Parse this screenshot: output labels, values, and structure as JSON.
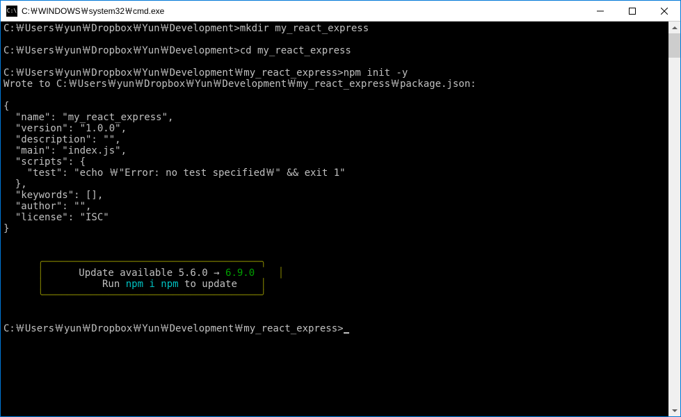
{
  "titlebar": {
    "icon_label": "C:\\",
    "title": "C:￦WINDOWS￦system32￦cmd.exe"
  },
  "terminal": {
    "prompt1": "C:￦Users￦yun￦Dropbox￦Yun￦Development>",
    "cmd1": "mkdir my_react_express",
    "prompt2": "C:￦Users￦yun￦Dropbox￦Yun￦Development>",
    "cmd2": "cd my_react_express",
    "prompt3": "C:￦Users￦yun￦Dropbox￦Yun￦Development￦my_react_express>",
    "cmd3": "npm init -y",
    "wrote_line": "Wrote to C:￦Users￦yun￦Dropbox￦Yun￦Development￦my_react_express￦package.json:",
    "json_open": "{",
    "json_name": "  \"name\": \"my_react_express\",",
    "json_version": "  \"version\": \"1.0.0\",",
    "json_description": "  \"description\": \"\",",
    "json_main": "  \"main\": \"index.js\",",
    "json_scripts_open": "  \"scripts\": {",
    "json_test": "    \"test\": \"echo ￦\"Error: no test specified￦\" && exit 1\"",
    "json_scripts_close": "  },",
    "json_keywords": "  \"keywords\": [],",
    "json_author": "  \"author\": \"\",",
    "json_license": "  \"license\": \"ISC\"",
    "json_close": "}",
    "update_text1_a": "      Update available 5.6.0 → ",
    "update_text1_b": "6.9.0",
    "update_text2_a": "          Run ",
    "update_text2_b": "npm i npm",
    "update_text2_c": " to update",
    "box_top": "   ╭─────────────────────────────────────╮",
    "box_side_l": "   │",
    "box_side_r": "    │",
    "box_bot": "   ╰─────────────────────────────────────╯",
    "prompt4": "C:￦Users￦yun￦Dropbox￦Yun￦Development￦my_react_express>"
  }
}
